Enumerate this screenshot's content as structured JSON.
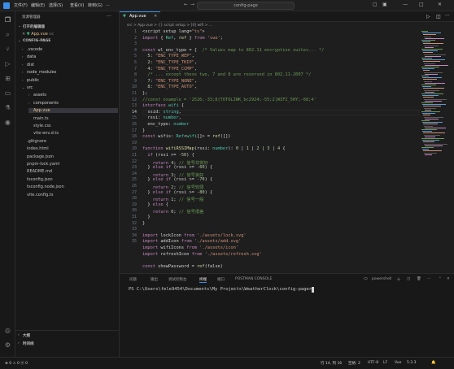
{
  "titlebar": {
    "menus": [
      "文件(F)",
      "编辑(E)",
      "选择(S)",
      "查看(V)",
      "转到(G)",
      "..."
    ],
    "command_center": "config-page"
  },
  "sidebar": {
    "header": "资源管理器",
    "open_editors_label": "打开的编辑器",
    "open_editor_file": "App.vue",
    "open_editor_path": "src",
    "project_label": "CONFIG-PAGE",
    "tree": [
      {
        "name": ".vscode",
        "kind": "folder"
      },
      {
        "name": "data",
        "kind": "folder"
      },
      {
        "name": "dist",
        "kind": "folder"
      },
      {
        "name": "node_modules",
        "kind": "folder"
      },
      {
        "name": "public",
        "kind": "folder"
      },
      {
        "name": "src",
        "kind": "folder-open"
      },
      {
        "name": "assets",
        "kind": "folder"
      },
      {
        "name": "components",
        "kind": "folder"
      },
      {
        "name": "App.vue",
        "kind": "file"
      },
      {
        "name": "main.ts",
        "kind": "file"
      },
      {
        "name": "style.css",
        "kind": "file"
      },
      {
        "name": "vite-env.d.ts",
        "kind": "file"
      },
      {
        "name": ".gitignore",
        "kind": "file"
      },
      {
        "name": "index.html",
        "kind": "file"
      },
      {
        "name": "package.json",
        "kind": "file"
      },
      {
        "name": "pnpm-lock.yaml",
        "kind": "file"
      },
      {
        "name": "README.md",
        "kind": "file"
      },
      {
        "name": "tsconfig.json",
        "kind": "file"
      },
      {
        "name": "tsconfig.node.json",
        "kind": "file"
      },
      {
        "name": "vite.config.ts",
        "kind": "file"
      }
    ],
    "outline_label": "大纲",
    "timeline_label": "时间线"
  },
  "editor": {
    "tab_label": "App.vue",
    "breadcrumb": "src > App.vue > {} script setup > [0] wifi > ...",
    "line_numbers": [
      "1",
      "2",
      "3",
      "4",
      "5",
      "6",
      "7",
      "8",
      "9",
      "10",
      "11",
      "12",
      "13",
      "14",
      "15",
      "16",
      "17",
      "18",
      "19",
      "20",
      "21",
      "22",
      "23",
      "24",
      "25",
      "26",
      "27",
      "28",
      "29",
      "30",
      "31",
      "32",
      "33",
      "34",
      "35"
    ],
    "code_lines": [
      "<script setup lang=\"ts\">",
      "import { Ref, ref } from 'vue';",
      "",
      "const wl_enc_type = {  /* Values map to 802.11 encryption suites... */",
      "  5: \"ENC_TYPE_WEP\",",
      "  2: \"ENC_TYPE_TKIP\",",
      "  4: \"ENC_TYPE_CCMP\",",
      "  /* ... except these two, 7 and 8 are reserved in 802.11-2007 */",
      "  7: \"ENC_TYPE_NONE\",",
      "  8: \"ENC_TYPE_AUTO\",",
      "};",
      "//const example = '2526;-33;8|TOTOLINK_bc2924;-55;2|WIFI_5HY;-68;4'",
      "interface wifi {",
      "  ssid: string,",
      "  rssi: number,",
      "  enc_type: number",
      "}",
      "const wifis: Ref<wifi[]> = ref([])",
      "",
      "function wifiRSSIMap(rssi: number): 0 | 1 | 2 | 3 | 4 {",
      "  if (rssi >= -50) {",
      "    return 4; // 信号非常好",
      "  } else if (rssi >= -60) {",
      "    return 3; // 信号良好",
      "  } else if (rssi >= -70) {",
      "    return 2; // 信号较弱",
      "  } else if (rssi >= -80) {",
      "    return 1; // 信号一般",
      "  } else {",
      "    return 0; // 信号很差",
      "  }",
      "}",
      "",
      "import lockIcon from './assets/lock.svg'",
      "import addIcon from './assets/add.svg'",
      "import wifiIcons from './assets/icon'",
      "import refreshIcon from './assets/refresh.svg'",
      "",
      "const showPassword = ref(false)"
    ]
  },
  "panel": {
    "tabs": [
      "问题",
      "输出",
      "调试控制台",
      "终端",
      "端口",
      "POSTMAN CONSOLE"
    ],
    "active_tab": "终端",
    "shell_label": "powershell",
    "prompt": "PS C:\\Users\\fele9454\\Documents\\My Projects\\WeatherClock\\config-page> "
  },
  "statusbar": {
    "left": "⊗ 0 ⚠ 0   ⓦ 0",
    "position": "行 14, 列 16",
    "spaces": "空格: 2",
    "encoding": "UTF-8",
    "eol": "LF",
    "language": "Vue",
    "ts_version": "5.3.3"
  }
}
